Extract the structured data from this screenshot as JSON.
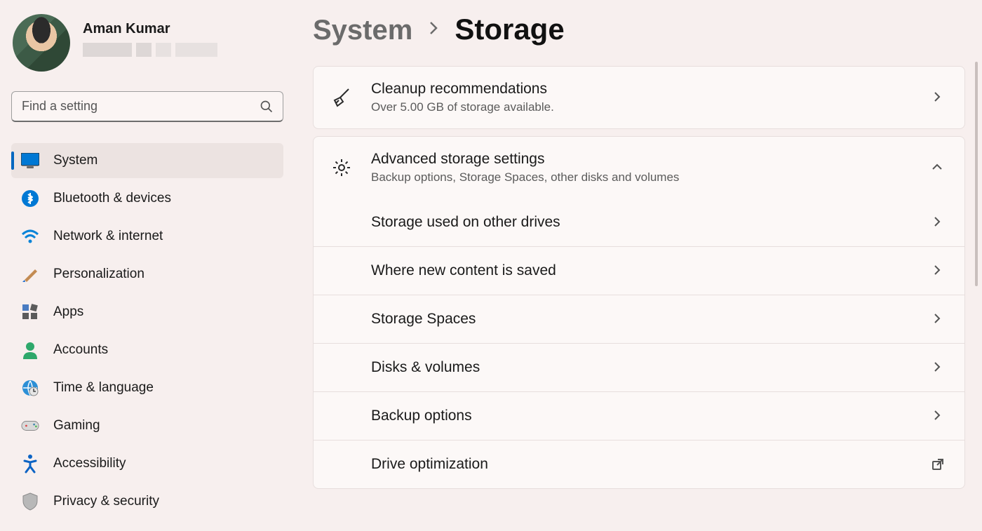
{
  "user": {
    "name": "Aman Kumar"
  },
  "search": {
    "placeholder": "Find a setting"
  },
  "nav": [
    {
      "id": "system",
      "label": "System",
      "active": true
    },
    {
      "id": "bluetooth",
      "label": "Bluetooth & devices",
      "active": false
    },
    {
      "id": "network",
      "label": "Network & internet",
      "active": false
    },
    {
      "id": "personalize",
      "label": "Personalization",
      "active": false
    },
    {
      "id": "apps",
      "label": "Apps",
      "active": false
    },
    {
      "id": "accounts",
      "label": "Accounts",
      "active": false
    },
    {
      "id": "time",
      "label": "Time & language",
      "active": false
    },
    {
      "id": "gaming",
      "label": "Gaming",
      "active": false
    },
    {
      "id": "accessibility",
      "label": "Accessibility",
      "active": false
    },
    {
      "id": "privacy",
      "label": "Privacy & security",
      "active": false
    }
  ],
  "breadcrumb": {
    "parent": "System",
    "current": "Storage"
  },
  "cards": {
    "cleanup": {
      "title": "Cleanup recommendations",
      "subtitle": "Over 5.00 GB of storage available."
    },
    "advanced": {
      "title": "Advanced storage settings",
      "subtitle": "Backup options, Storage Spaces, other disks and volumes",
      "expanded": true,
      "items": [
        {
          "id": "other-drives",
          "label": "Storage used on other drives",
          "action": "navigate"
        },
        {
          "id": "where-saved",
          "label": "Where new content is saved",
          "action": "navigate"
        },
        {
          "id": "spaces",
          "label": "Storage Spaces",
          "action": "navigate"
        },
        {
          "id": "disks",
          "label": "Disks & volumes",
          "action": "navigate"
        },
        {
          "id": "backup",
          "label": "Backup options",
          "action": "navigate"
        },
        {
          "id": "optimize",
          "label": "Drive optimization",
          "action": "external"
        }
      ]
    }
  }
}
